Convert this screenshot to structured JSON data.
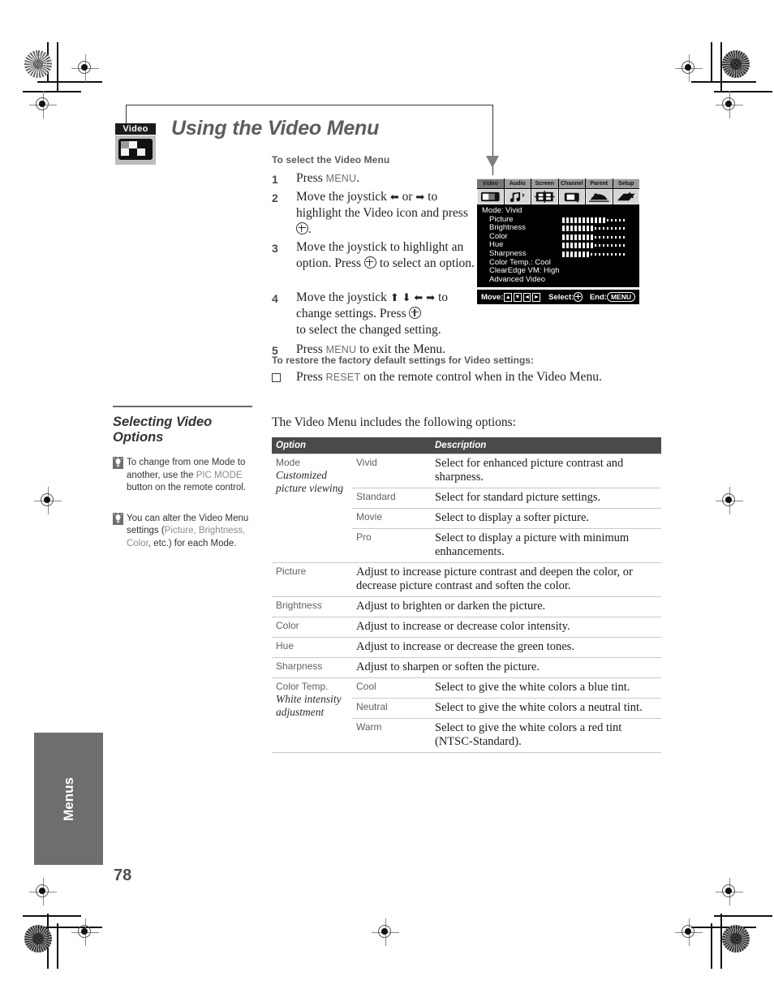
{
  "page": {
    "number": "78",
    "tab_label": "Menus",
    "title": "Using the Video Menu",
    "badge_label": "Video"
  },
  "procedure": {
    "heading": "To select the Video Menu",
    "steps": [
      {
        "num": "1",
        "pre": "Press ",
        "key": "MENU",
        "post": "."
      },
      {
        "num": "2",
        "pre": "Move the joystick ",
        "key": "",
        "post": " to highlight the Video icon and press "
      },
      {
        "num": "3",
        "pre": "Move the joystick to highlight an option. Press ",
        "key": "",
        "post": " to select an option."
      },
      {
        "num": "4",
        "pre": "Move the joystick ",
        "key": "",
        "post": " to change settings. Press "
      },
      {
        "num": "5",
        "pre": "Press ",
        "key": "MENU",
        "post": " to exit the Menu."
      }
    ],
    "step2_text_a": "Move the joystick",
    "step2_or": "or",
    "step2_text_b": "to highlight the Video icon and press",
    "step3_text_a": "Move the joystick to highlight an option. Press",
    "step3_text_b": "to select an option.",
    "step4_text_a": "Move the joystick",
    "step4_text_b": "to change settings. Press",
    "step4_text_c": "to select the changed setting.",
    "step5_text_a": "Press",
    "step5_key": "MENU",
    "step5_text_b": "to exit the Menu."
  },
  "restore": {
    "heading": "To restore the factory default settings for Video settings:",
    "text_a": "Press",
    "key": "RESET",
    "text_b": "on the remote control when in the Video Menu."
  },
  "osd": {
    "tabs": [
      "Video",
      "Audio",
      "Screen",
      "Channel",
      "Parent",
      "Setup"
    ],
    "icon_names": [
      "video-icon",
      "audio-icon",
      "screen-icon",
      "channel-icon",
      "parent-icon",
      "setup-icon"
    ],
    "mode_line": "Mode: Vivid",
    "items": [
      {
        "label": "Picture",
        "bar": true,
        "filled": 11,
        "total": 16
      },
      {
        "label": "Brightness",
        "bar": true,
        "filled": 8,
        "total": 16
      },
      {
        "label": "Color",
        "bar": true,
        "filled": 8,
        "total": 16
      },
      {
        "label": "Hue",
        "bar": true,
        "filled": 8,
        "total": 16
      },
      {
        "label": "Sharpness",
        "bar": true,
        "filled": 7,
        "total": 16
      }
    ],
    "text_items": [
      "Color Temp.: Cool",
      "ClearEdge VM: High",
      "Advanced Video"
    ],
    "footer": {
      "move_label": "Move:",
      "keys": [
        "▲",
        "▼",
        "◄",
        "►"
      ],
      "select_label": "Select:",
      "end_label": "End:",
      "end_key": "MENU"
    }
  },
  "sidebar": {
    "section_title": "Selecting Video Options",
    "tips": [
      {
        "icon": "lightbulb-icon",
        "part1": "To change from one Mode to another, use the ",
        "highlight": "PIC MODE",
        "part2": " button on the remote control."
      },
      {
        "icon": "lightbulb-icon",
        "part1": "You can alter the Video Menu settings (",
        "highlight": "Picture, Brightness, Color",
        "part2": ", etc.) for each Mode."
      }
    ]
  },
  "table": {
    "intro": "The Video Menu includes the following options:",
    "headers": [
      "Option",
      "Description"
    ],
    "rows": [
      {
        "option": "Mode",
        "option_sub": "Customized picture viewing",
        "sub_rows": [
          {
            "value": "Vivid",
            "desc": "Select for enhanced picture contrast and sharpness."
          },
          {
            "value": "Standard",
            "desc": "Select for standard picture settings."
          },
          {
            "value": "Movie",
            "desc": "Select to display a softer picture."
          },
          {
            "value": "Pro",
            "desc": "Select to display a picture with minimum enhancements."
          }
        ]
      },
      {
        "option": "Picture",
        "option_sub": "",
        "sub_rows": [
          {
            "value": "",
            "desc": "Adjust to increase picture contrast and deepen the color, or decrease picture contrast and soften the color."
          }
        ]
      },
      {
        "option": "Brightness",
        "option_sub": "",
        "sub_rows": [
          {
            "value": "",
            "desc": "Adjust to brighten or darken the picture."
          }
        ]
      },
      {
        "option": "Color",
        "option_sub": "",
        "sub_rows": [
          {
            "value": "",
            "desc": "Adjust to increase or decrease color intensity."
          }
        ]
      },
      {
        "option": "Hue",
        "option_sub": "",
        "sub_rows": [
          {
            "value": "",
            "desc": "Adjust to increase or decrease the green tones."
          }
        ]
      },
      {
        "option": "Sharpness",
        "option_sub": "",
        "sub_rows": [
          {
            "value": "",
            "desc": "Adjust to sharpen or soften the picture."
          }
        ]
      },
      {
        "option": "Color Temp.",
        "option_sub": "White intensity adjustment",
        "sub_rows": [
          {
            "value": "Cool",
            "desc": "Select to give the white colors a blue tint."
          },
          {
            "value": "Neutral",
            "desc": "Select to give the white colors a neutral tint."
          },
          {
            "value": "Warm",
            "desc": "Select to give the white colors a red tint (NTSC-Standard)."
          }
        ]
      }
    ]
  },
  "colors": {
    "header_bg": "#4a4a4a",
    "tab_bg": "#6e6e6e",
    "title_gray": "#5d5d5d",
    "label_gray": "#616161",
    "highlight_gray": "#8c8c8c"
  }
}
